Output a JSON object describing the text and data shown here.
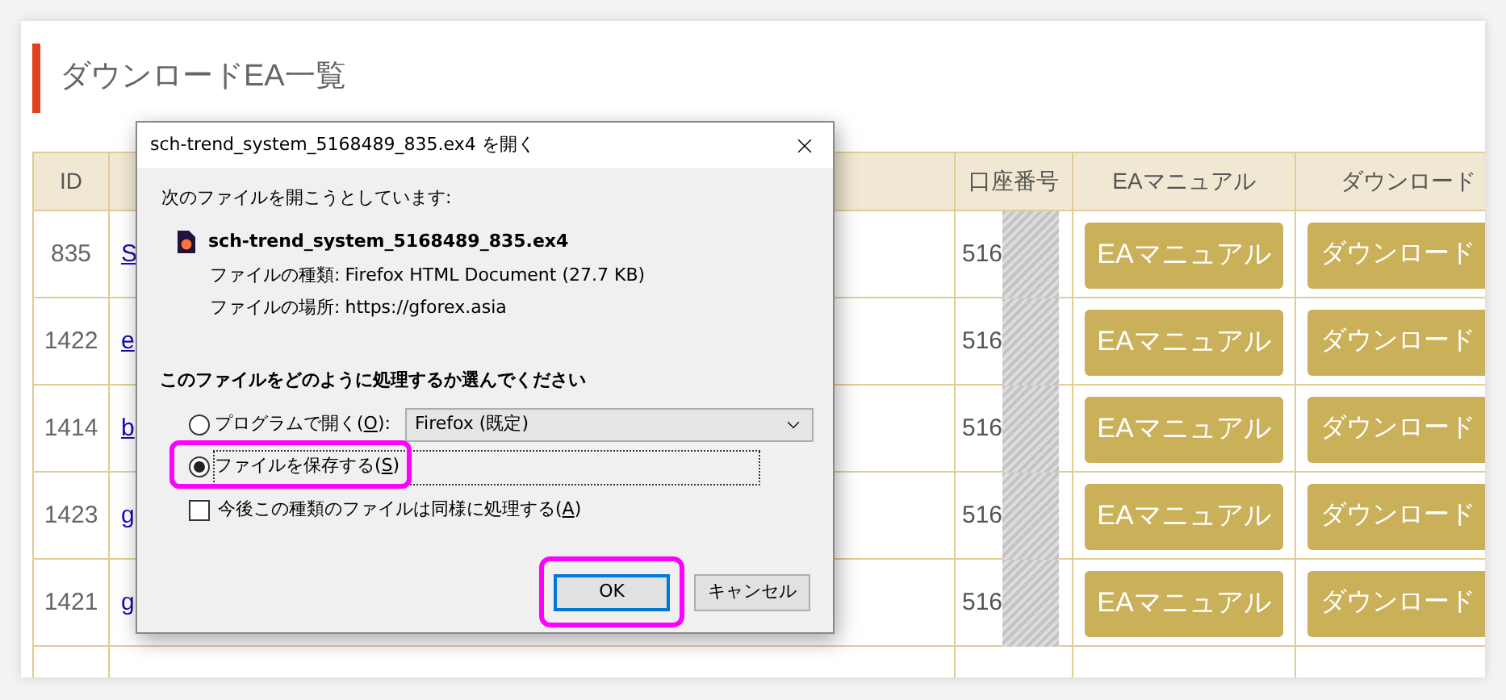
{
  "page": {
    "title": "ダウンロードEA一覧"
  },
  "table": {
    "columns": [
      {
        "label": "ID"
      },
      {
        "label": "口座番号"
      },
      {
        "label": "EAマニュアル"
      },
      {
        "label": "ダウンロード"
      }
    ],
    "rows": [
      {
        "id": "835",
        "name": "S",
        "account": "516",
        "redacted": true,
        "manual_button": "EAマニュアル",
        "download_button": "ダウンロード"
      },
      {
        "id": "1422",
        "name": "e",
        "account": "516",
        "redacted": true,
        "manual_button": "EAマニュアル",
        "download_button": "ダウンロード"
      },
      {
        "id": "1414",
        "name": "b",
        "account": "516",
        "redacted": true,
        "manual_button": "EAマニュアル",
        "download_button": "ダウンロード"
      },
      {
        "id": "1423",
        "name": "g",
        "account": "516",
        "redacted": true,
        "manual_button": "EAマニュアル",
        "download_button": "ダウンロード"
      },
      {
        "id": "1421",
        "name": "g",
        "account": "516",
        "redacted": true,
        "manual_button": "EAマニュアル",
        "download_button": "ダウンロード"
      }
    ]
  },
  "dialog": {
    "title": "sch-trend_system_5168489_835.ex4 を開く",
    "intro": "次のファイルを開こうとしています:",
    "file_name": "sch-trend_system_5168489_835.ex4",
    "details": [
      {
        "label": "ファイルの種類:",
        "value": "Firefox HTML Document (27.7 KB)"
      },
      {
        "label": "ファイルの場所:",
        "value": "https://gforex.asia"
      }
    ],
    "question": "このファイルをどのように処理するか選んでください",
    "options": [
      {
        "before": "プログラムで開く(",
        "key": "O",
        "after": "):",
        "selected": false,
        "focused": false,
        "highlighted": false,
        "app": "Firefox (既定)"
      },
      {
        "before": "ファイルを保存する(",
        "key": "S",
        "after": ")",
        "selected": true,
        "focused": true,
        "highlighted": true
      }
    ],
    "remember": {
      "before": "今後この種類のファイルは同様に処理する(",
      "key": "A",
      "after": ")",
      "checked": false
    },
    "buttons": [
      {
        "label": "OK",
        "default": true,
        "highlighted": true
      },
      {
        "label": "キャンセル",
        "default": false,
        "highlighted": false
      }
    ]
  }
}
